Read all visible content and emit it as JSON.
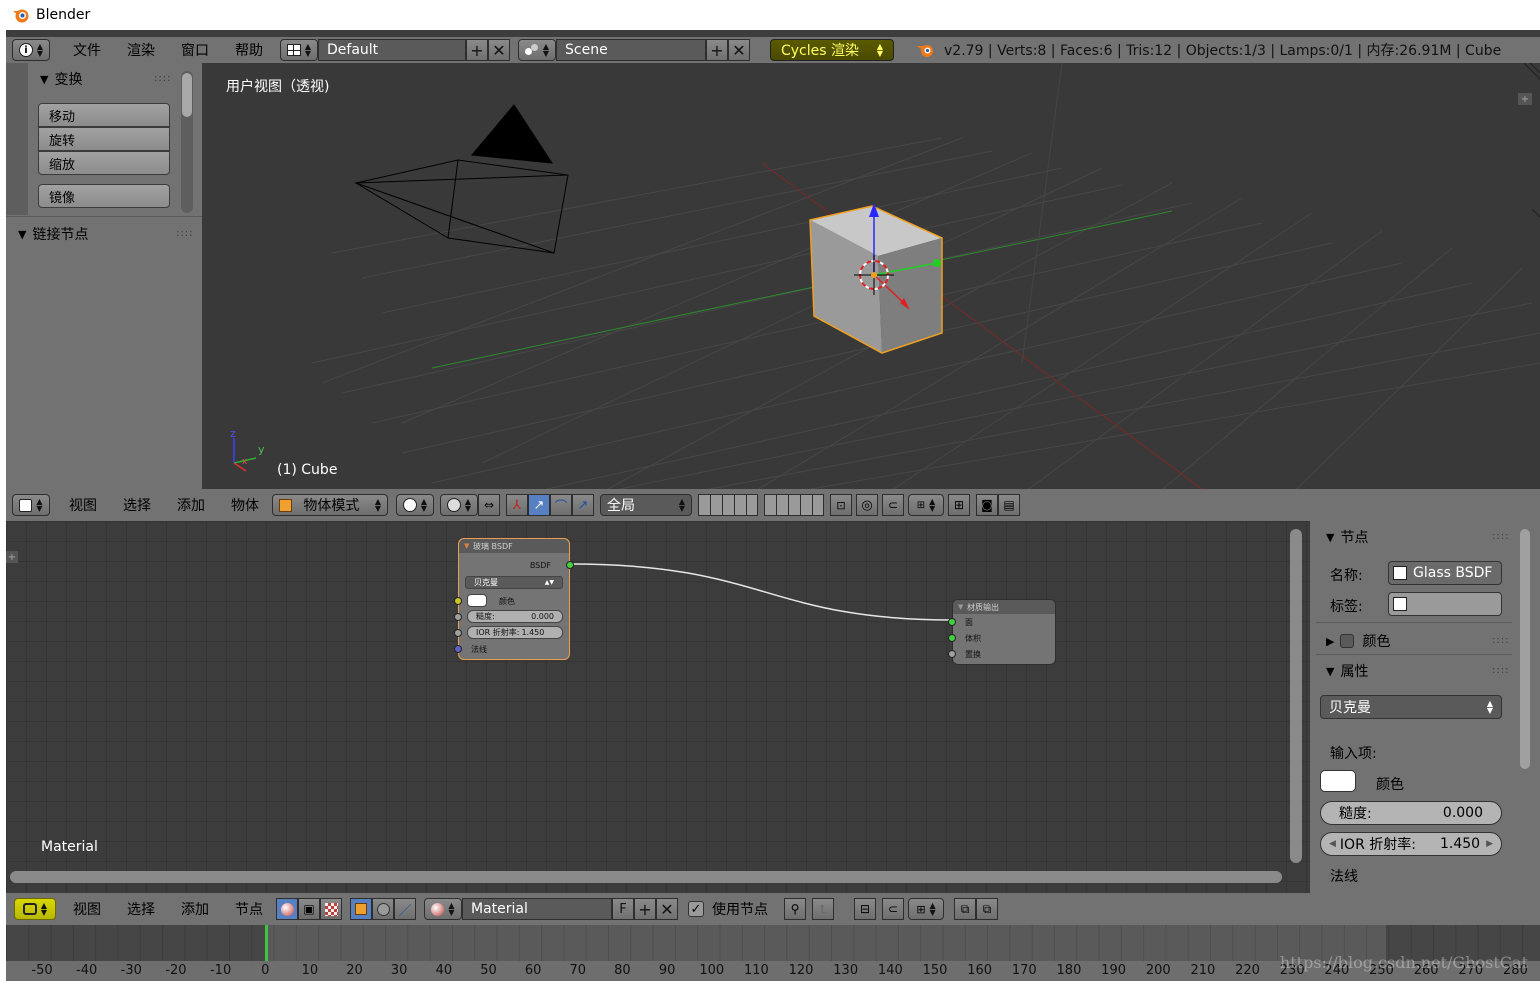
{
  "window": {
    "title": "Blender"
  },
  "info_header": {
    "menus": [
      "文件",
      "渲染",
      "窗口",
      "帮助"
    ],
    "layout": "Default",
    "scene": "Scene",
    "engine": "Cycles 渲染",
    "stats": "v2.79 | Verts:8 | Faces:6 | Tris:12 | Objects:1/3 | Lamps:0/1 | 内存:26.91M | Cube"
  },
  "tool_shelf": {
    "transform_header": "变换",
    "buttons": [
      "移动",
      "旋转",
      "缩放"
    ],
    "mirror": "镜像",
    "link_nodes_header": "链接节点"
  },
  "viewport": {
    "label": "用户视图（透视)",
    "object_label": "(1) Cube",
    "axis_z": "z",
    "axis_y": "y",
    "axis_x": "x"
  },
  "view3d_header": {
    "menus": [
      "视图",
      "选择",
      "添加",
      "物体"
    ],
    "mode": "物体模式",
    "orientation": "全局"
  },
  "nodes": {
    "glass": {
      "title": "玻璃 BSDF",
      "output": "BSDF",
      "distribution": "贝克曼",
      "color_label": "颜色",
      "roughness_label": "糙度:",
      "roughness": "0.000",
      "ior_label": "IOR 折射率:",
      "ior": "1.450",
      "normal_label": "法线"
    },
    "output": {
      "title": "材质输出",
      "surface": "面",
      "volume": "体积",
      "displacement": "置换"
    },
    "material_label": "Material"
  },
  "properties": {
    "node_header": "节点",
    "name_label": "名称:",
    "name_value": "Glass BSDF",
    "tag_label": "标签:",
    "color_header": "颜色",
    "attr_header": "属性",
    "distribution": "贝克曼",
    "inputs_label": "输入项:",
    "color_label": "颜色",
    "roughness_label": "糙度:",
    "roughness": "0.000",
    "ior_label": "IOR 折射率:",
    "ior": "1.450",
    "normal_label": "法线"
  },
  "node_header": {
    "menus": [
      "视图",
      "选择",
      "添加",
      "节点"
    ],
    "material": "Material",
    "fake_user": "F",
    "use_nodes_label": "使用节点",
    "use_nodes_checked": true
  },
  "timeline": {
    "ticks": [
      "-50",
      "-40",
      "-30",
      "-20",
      "-10",
      "0",
      "10",
      "20",
      "30",
      "40",
      "50",
      "60",
      "70",
      "80",
      "90",
      "100",
      "110",
      "120",
      "130",
      "140",
      "150",
      "160",
      "170",
      "180",
      "190",
      "200",
      "210",
      "220",
      "230",
      "240",
      "250",
      "260",
      "270",
      "280"
    ],
    "current_frame": 0,
    "watermark": "https://blog.csdn.net/GhostCat"
  }
}
